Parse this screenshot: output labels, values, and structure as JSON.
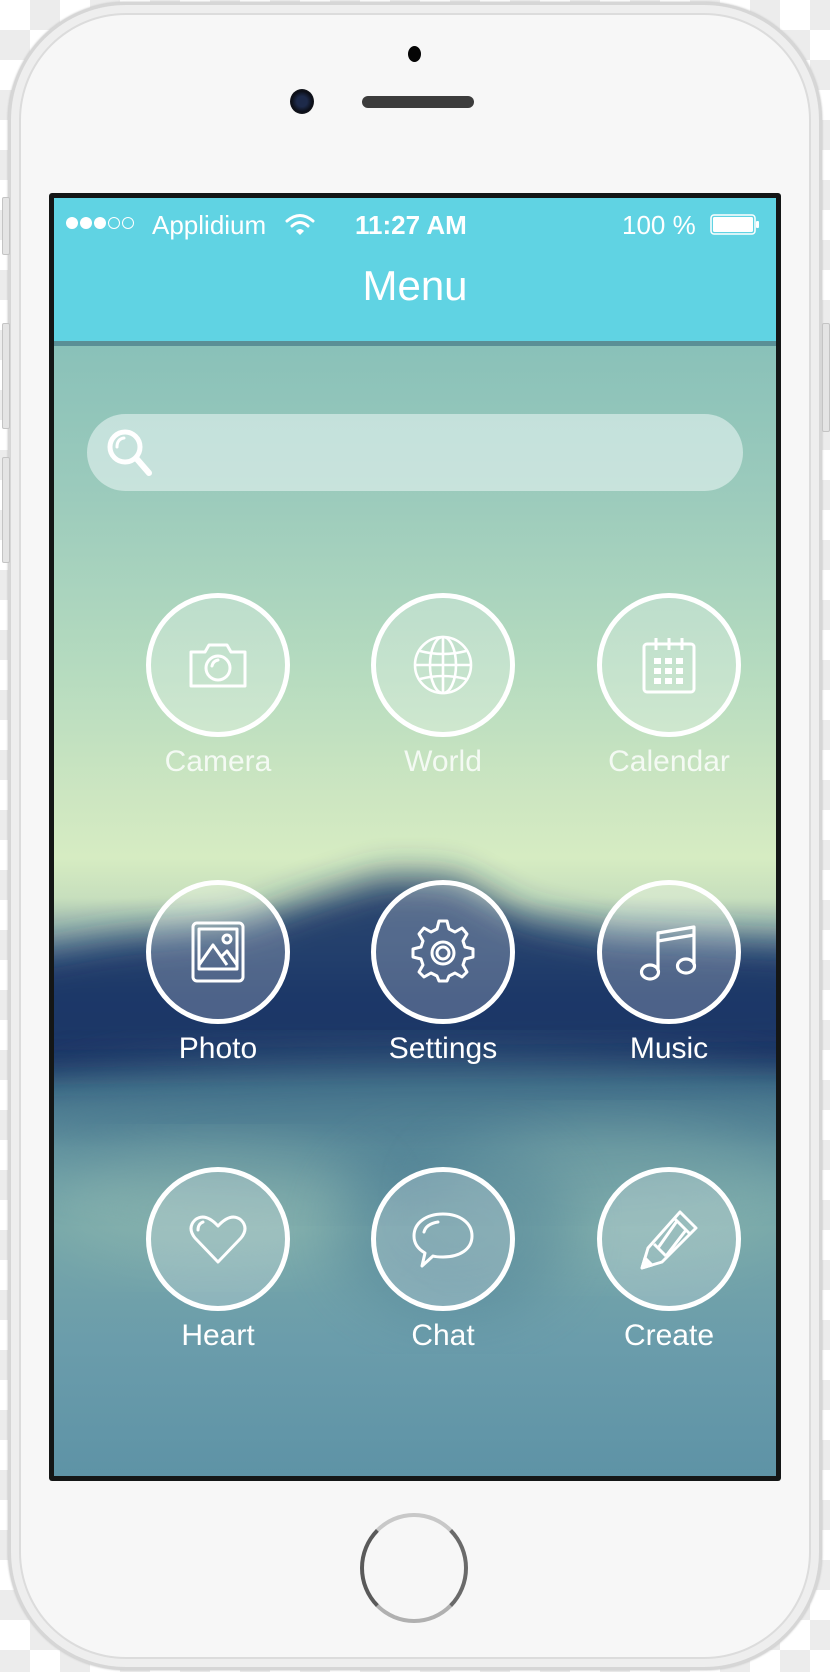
{
  "status_bar": {
    "signal_bars_filled": 3,
    "signal_bars_total": 5,
    "carrier": "Applidium",
    "wifi_icon": "wifi-icon",
    "time": "11:27 AM",
    "battery_percent": "100 %",
    "battery_level": 1.0
  },
  "header": {
    "title": "Menu",
    "color": "#60d3e3"
  },
  "search": {
    "icon": "search-icon",
    "value": "",
    "placeholder": ""
  },
  "menu": {
    "items": [
      {
        "label": "Camera",
        "icon": "camera-icon"
      },
      {
        "label": "World",
        "icon": "globe-icon"
      },
      {
        "label": "Calendar",
        "icon": "calendar-icon"
      },
      {
        "label": "Photo",
        "icon": "photo-icon"
      },
      {
        "label": "Settings",
        "icon": "gear-icon"
      },
      {
        "label": "Music",
        "icon": "music-note-icon"
      },
      {
        "label": "Heart",
        "icon": "heart-icon"
      },
      {
        "label": "Chat",
        "icon": "chat-bubble-icon"
      },
      {
        "label": "Create",
        "icon": "pencil-icon"
      }
    ]
  },
  "device": {
    "home_button": "home-button"
  }
}
